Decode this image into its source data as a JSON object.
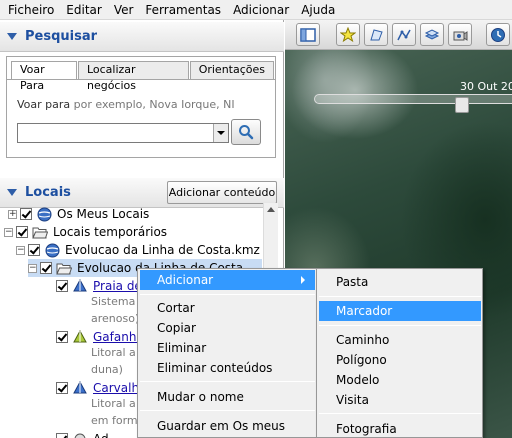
{
  "menubar": {
    "items": [
      "Ficheiro",
      "Editar",
      "Ver",
      "Ferramentas",
      "Adicionar",
      "Ajuda"
    ]
  },
  "search": {
    "title": "Pesquisar",
    "tabs": [
      "Voar Para",
      "Localizar negócios",
      "Orientações"
    ],
    "fly_label": "Voar para",
    "fly_example": "por exemplo, Nova Iorque, NI",
    "input_value": ""
  },
  "places": {
    "title": "Locais",
    "add_content": "Adicionar conteúdo",
    "tree": [
      {
        "label": "Os Meus Locais"
      },
      {
        "label": "Locais temporários"
      },
      {
        "label": "Evolucao da Linha de Costa.kmz"
      },
      {
        "label": "Evolucao da Linha de Costa"
      },
      {
        "label": "Praia de",
        "desc": [
          "Sistema",
          "arenoso)"
        ]
      },
      {
        "label": "Gafanha",
        "desc": [
          "Litoral a",
          "duna)"
        ]
      },
      {
        "label": "Carvalha",
        "desc": [
          "Litoral a",
          "em forma"
        ]
      },
      {
        "label": "Ad"
      }
    ]
  },
  "map": {
    "time_label": "30 Out 20"
  },
  "context_menu": {
    "items": [
      {
        "label": "Adicionar",
        "submenu": true
      },
      {
        "label": "Cortar"
      },
      {
        "label": "Copiar"
      },
      {
        "label": "Eliminar"
      },
      {
        "label": "Eliminar conteúdos"
      },
      {
        "label": "Mudar o nome"
      },
      {
        "label": "Guardar em Os meus locais"
      }
    ],
    "submenu": [
      {
        "label": "Pasta"
      },
      {
        "label": "Marcador"
      },
      {
        "label": "Caminho"
      },
      {
        "label": "Polígono"
      },
      {
        "label": "Modelo"
      },
      {
        "label": "Visita"
      },
      {
        "label": "Fotografia"
      }
    ]
  },
  "colors": {
    "header_text": "#1d4fa0",
    "highlight": "#3399ff",
    "link": "#1a0dab"
  }
}
